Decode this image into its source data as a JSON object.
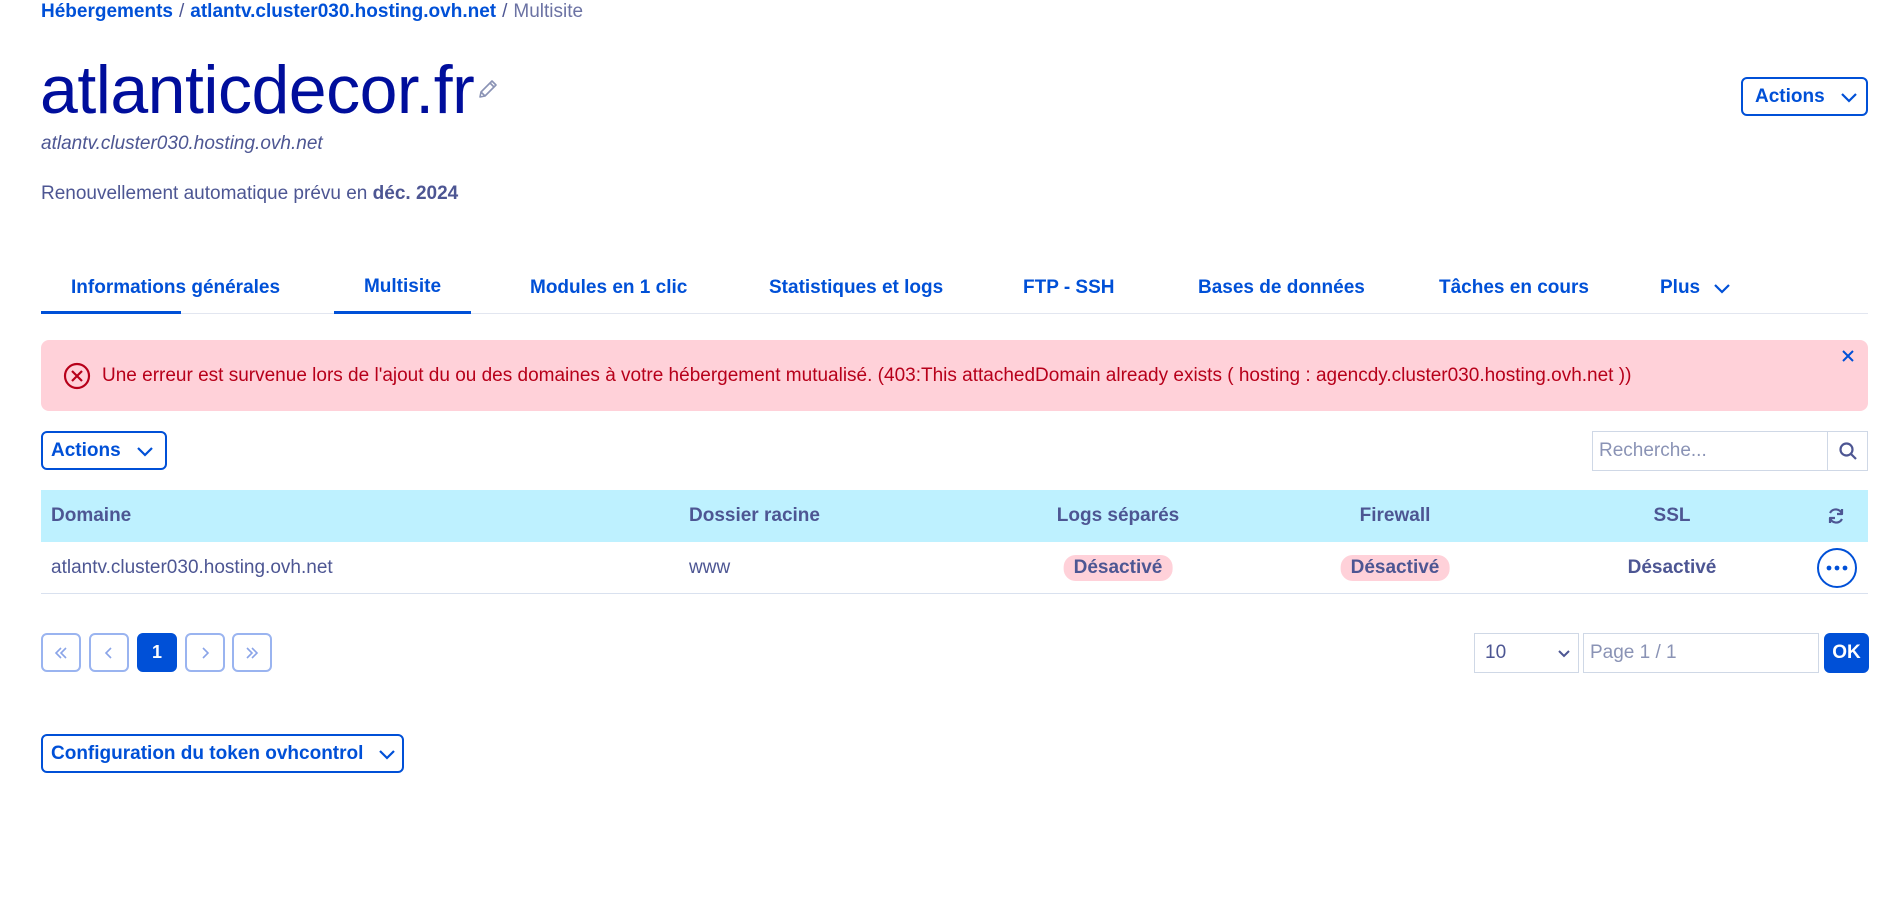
{
  "breadcrumb": {
    "items": [
      "Hébergements",
      "atlantv.cluster030.hosting.ovh.net"
    ],
    "separator": "/",
    "current": "Multisite"
  },
  "header": {
    "title": "atlanticdecor.fr",
    "subtitle": "atlantv.cluster030.hosting.ovh.net",
    "renewal_prefix": "Renouvellement automatique prévu en",
    "renewal_date": "déc. 2024",
    "actions_label": "Actions"
  },
  "tabs": [
    {
      "label": "Informations générales"
    },
    {
      "label": "Multisite"
    },
    {
      "label": "Modules en 1 clic"
    },
    {
      "label": "Statistiques et logs"
    },
    {
      "label": "FTP - SSH"
    },
    {
      "label": "Bases de données"
    },
    {
      "label": "Tâches en cours"
    },
    {
      "label": "Plus"
    }
  ],
  "alert": {
    "message": "Une erreur est survenue lors de l'ajout du ou des domaines à votre hébergement mutualisé. (403:This attachedDomain already exists ( hosting : agencdy.cluster030.hosting.ovh.net ))"
  },
  "toolbar": {
    "actions_label": "Actions",
    "search_placeholder": "Recherche..."
  },
  "table": {
    "columns": [
      "Domaine",
      "Dossier racine",
      "Logs séparés",
      "Firewall",
      "SSL"
    ],
    "rows": [
      {
        "domain": "atlantv.cluster030.hosting.ovh.net",
        "root": "www",
        "logs": "Désactivé",
        "firewall": "Désactivé",
        "ssl": "Désactivé"
      }
    ]
  },
  "pagination": {
    "current_page": "1",
    "page_size": "10",
    "page_placeholder": "Page 1 / 1",
    "ok_label": "OK"
  },
  "token": {
    "label": "Configuration du token ovhcontrol"
  },
  "colors": {
    "primary": "#0050d7",
    "title": "#000e9c",
    "text": "#4d5693",
    "alert_bg": "#ffd1d9",
    "alert_text": "#b7001a",
    "table_header_bg": "#bef1ff"
  }
}
